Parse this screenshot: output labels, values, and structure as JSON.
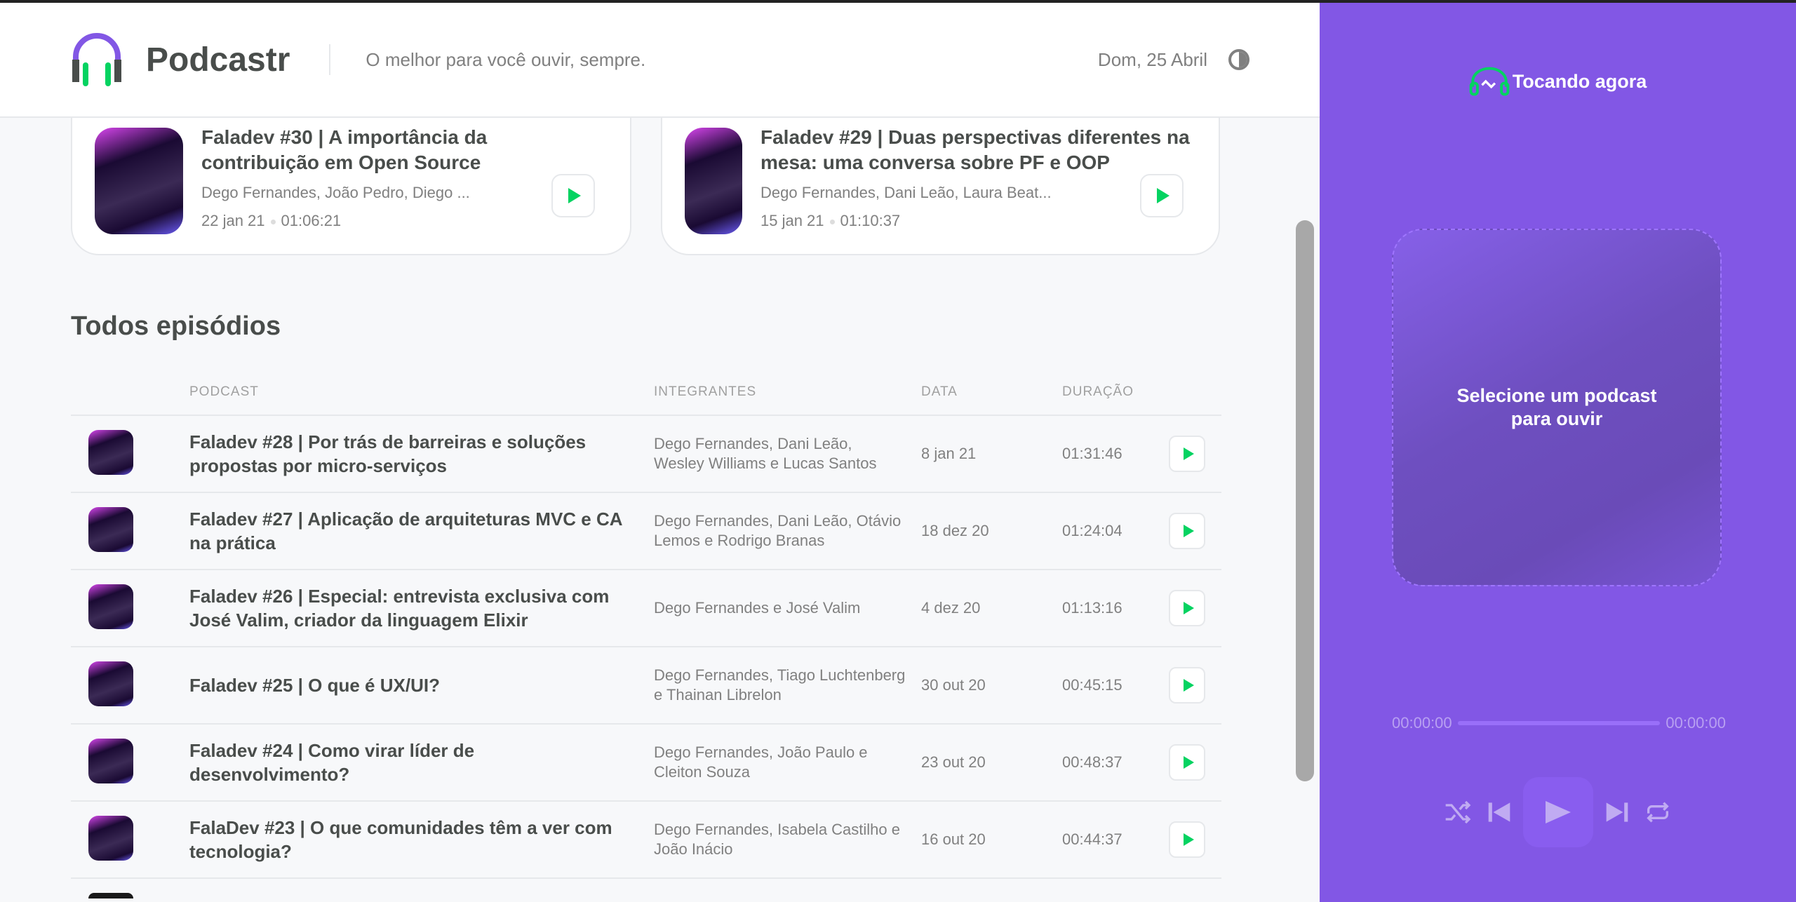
{
  "header": {
    "brand": "Podcastr",
    "tagline": "O melhor para você ouvir, sempre.",
    "date": "Dom, 25 Abril",
    "theme_icon": "contrast-icon"
  },
  "latest": [
    {
      "title": "Faladev #30 | A importância da contribuição em Open Source",
      "members": "Dego Fernandes, João Pedro, Diego ...",
      "date": "22 jan 21",
      "duration": "01:06:21"
    },
    {
      "title": "Faladev #29 | Duas perspectivas diferentes na mesa: uma conversa sobre PF e OOP",
      "members": "Dego Fernandes, Dani Leão, Laura Beat...",
      "date": "15 jan 21",
      "duration": "01:10:37"
    }
  ],
  "all": {
    "heading": "Todos episódios",
    "columns": [
      "Podcast",
      "Integrantes",
      "Data",
      "Duração"
    ],
    "rows": [
      {
        "title": "Faladev #28 | Por trás de barreiras e soluções propostas por micro-serviços",
        "members": "Dego Fernandes, Dani Leão, Wesley Williams e Lucas Santos",
        "date": "8 jan 21",
        "duration": "01:31:46"
      },
      {
        "title": "Faladev #27 | Aplicação de arquiteturas MVC e CA na prática",
        "members": "Dego Fernandes, Dani Leão, Otávio Lemos e Rodrigo Branas",
        "date": "18 dez 20",
        "duration": "01:24:04"
      },
      {
        "title": "Faladev #26 | Especial: entrevista exclusiva com José Valim, criador da linguagem Elixir",
        "members": "Dego Fernandes e José Valim",
        "date": "4 dez 20",
        "duration": "01:13:16"
      },
      {
        "title": "Faladev #25 | O que é UX/UI?",
        "members": "Dego Fernandes, Tiago Luchtenberg e Thainan Librelon",
        "date": "30 out 20",
        "duration": "00:45:15"
      },
      {
        "title": "Faladev #24 | Como virar líder de desenvolvimento?",
        "members": "Dego Fernandes, João Paulo e Cleiton Souza",
        "date": "23 out 20",
        "duration": "00:48:37"
      },
      {
        "title": "FalaDev #23 | O que comunidades têm a ver com tecnologia?",
        "members": "Dego Fernandes, Isabela Castilho e João Inácio",
        "date": "16 out 20",
        "duration": "00:44:37"
      }
    ]
  },
  "player": {
    "title": "Tocando agora",
    "empty": "Selecione um podcast para ouvir",
    "current_time": "00:00:00",
    "total_time": "00:00:00",
    "progress": 0,
    "accent": "#8257e5",
    "play_color": "#04d361"
  }
}
